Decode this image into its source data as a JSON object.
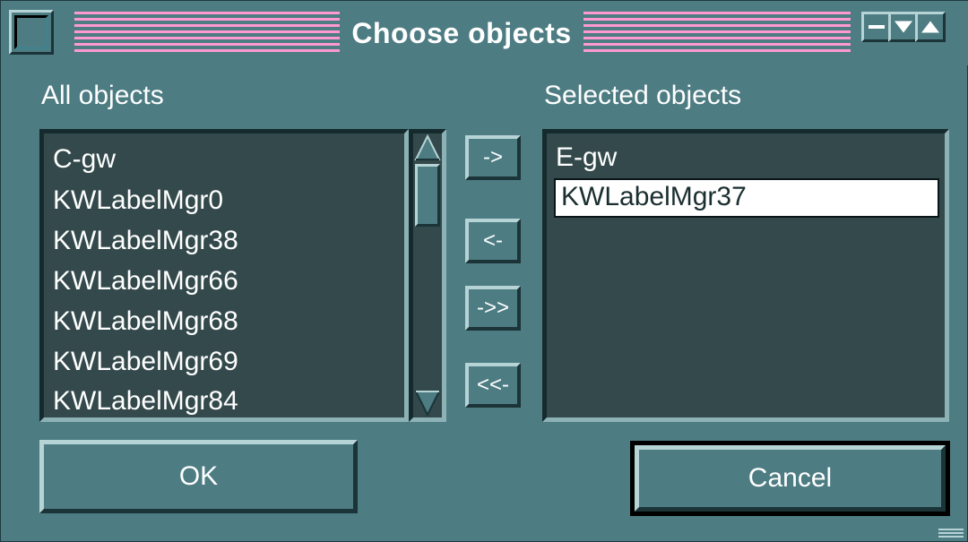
{
  "window": {
    "title": "Choose objects",
    "controls": {
      "menu": "window-menu-icon",
      "minimize": "minimize-icon",
      "shade": "shade-icon",
      "maximize": "maximize-icon"
    }
  },
  "all_objects": {
    "label": "All objects",
    "items": [
      "C-gw",
      "KWLabelMgr0",
      "KWLabelMgr38",
      "KWLabelMgr66",
      "KWLabelMgr68",
      "KWLabelMgr69",
      "KWLabelMgr84"
    ]
  },
  "selected_objects": {
    "label": "Selected objects",
    "items": [
      "E-gw",
      "KWLabelMgr37"
    ],
    "active_item": "KWLabelMgr37"
  },
  "transfer": {
    "add": "->",
    "remove": "<-",
    "add_all": "->>",
    "remove_all": "<<-"
  },
  "buttons": {
    "ok": "OK",
    "cancel": "Cancel"
  },
  "colors": {
    "background": "#4d7c83",
    "list_background": "#33494b",
    "title_stripes": "#ff9ad0",
    "text": "#ffffff"
  }
}
